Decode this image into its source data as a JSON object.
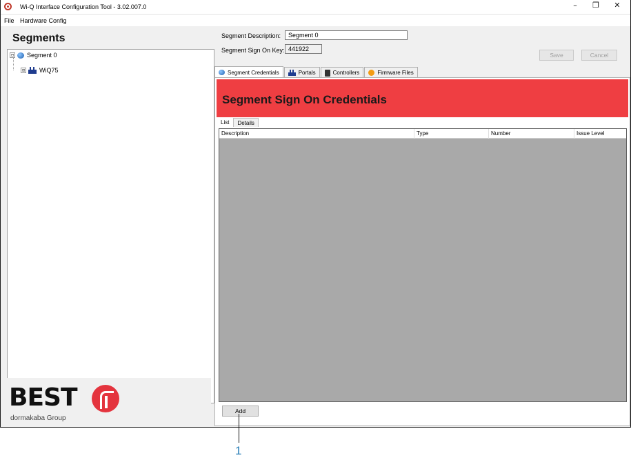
{
  "window": {
    "title": "Wi-Q Interface Configuration Tool - 3.02.007.0",
    "controls": {
      "minimize": "–",
      "restore": "❐",
      "close": "✕"
    }
  },
  "menu": [
    "File",
    "Hardware Config"
  ],
  "sidebar": {
    "title": "Segments",
    "tree": [
      {
        "label": "Segment 0",
        "expander": "⊟",
        "icon": "globe-icon"
      },
      {
        "label": "WiQ75",
        "expander": "⊞",
        "icon": "portal-icon"
      }
    ]
  },
  "logo": {
    "brand": "BEST",
    "subtitle": "dormakaba Group"
  },
  "form": {
    "description_label": "Segment Description:",
    "description_value": "Segment 0",
    "signon_label": "Segment Sign On Key:",
    "signon_value": "441922",
    "save_label": "Save",
    "cancel_label": "Cancel"
  },
  "tabs": [
    {
      "label": "Segment Credentials",
      "icon": "globe-icon",
      "active": true
    },
    {
      "label": "Portals",
      "icon": "portal-icon",
      "active": false
    },
    {
      "label": "Controllers",
      "icon": "controller-icon",
      "active": false
    },
    {
      "label": "Firmware Files",
      "icon": "firmware-icon",
      "active": false
    }
  ],
  "banner": {
    "title": "Segment Sign On Credentials",
    "color": "#ef3e42"
  },
  "subtabs": [
    "List",
    "Details"
  ],
  "grid": {
    "columns": [
      "Description",
      "Type",
      "Number",
      "Issue Level"
    ],
    "rows": []
  },
  "add_label": "Add",
  "callout": "1"
}
